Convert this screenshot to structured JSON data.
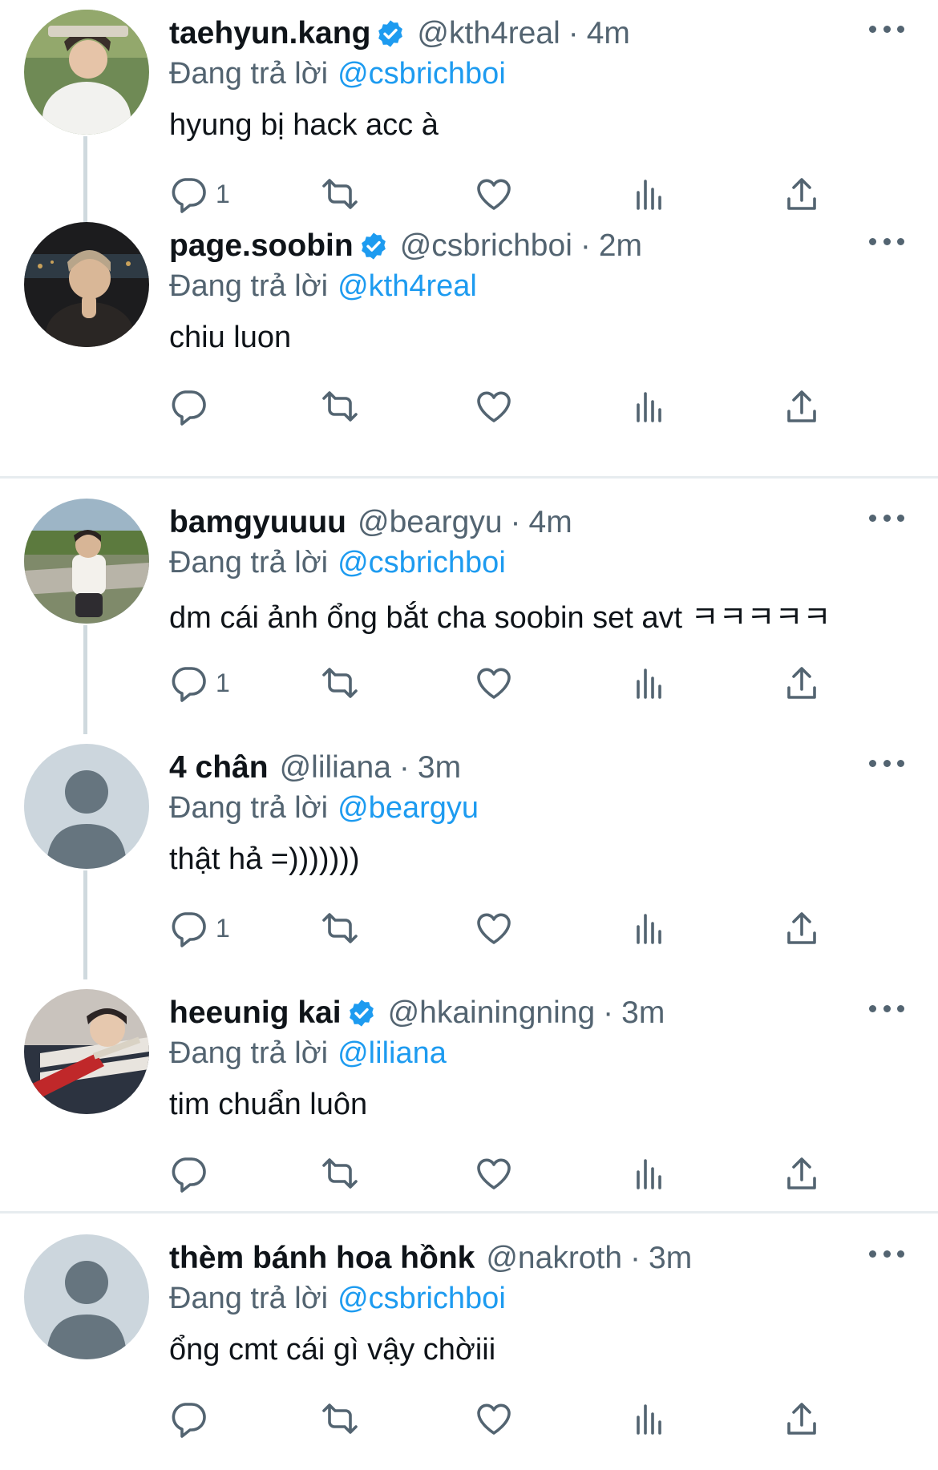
{
  "reply_prefix": "Đang trả lời",
  "verified_icon": "verified-badge-icon",
  "colors": {
    "accent": "#1d9bf0",
    "secondary_text": "#536471",
    "thread_line": "#cfd9de",
    "separator": "#e7ecef"
  },
  "tweets": [
    {
      "name": "taehyun.kang",
      "verified": true,
      "handle": "@kth4real",
      "time": "4m",
      "reply_to": "@csbrichboi",
      "text": "hyung bị hack acc à",
      "reply_count": "1",
      "avatar": "photo"
    },
    {
      "name": "page.soobin",
      "verified": true,
      "handle": "@csbrichboi",
      "time": "2m",
      "reply_to": "@kth4real",
      "text": "chiu luon",
      "reply_count": "",
      "avatar": "photo"
    },
    {
      "name": "bamgyuuuu",
      "verified": false,
      "handle": "@beargyu",
      "time": "4m",
      "reply_to": "@csbrichboi",
      "text": "dm cái ảnh ổng bắt cha soobin set avt ㅋㅋㅋㅋㅋ",
      "reply_count": "1",
      "avatar": "photo"
    },
    {
      "name": "4 chân",
      "verified": false,
      "handle": "@liliana",
      "time": "3m",
      "reply_to": "@beargyu",
      "text": "thật hả =)))))))",
      "reply_count": "1",
      "avatar": "default"
    },
    {
      "name": "heeunig kai",
      "verified": true,
      "handle": "@hkainingning",
      "time": "3m",
      "reply_to": "@liliana",
      "text": "tim chuẩn luôn",
      "reply_count": "",
      "avatar": "photo"
    },
    {
      "name": "thèm bánh hoa hồnk",
      "verified": false,
      "handle": "@nakroth",
      "time": "3m",
      "reply_to": "@csbrichboi",
      "text": "ổng cmt cái gì vậy chờiii",
      "reply_count": "",
      "avatar": "default"
    }
  ]
}
